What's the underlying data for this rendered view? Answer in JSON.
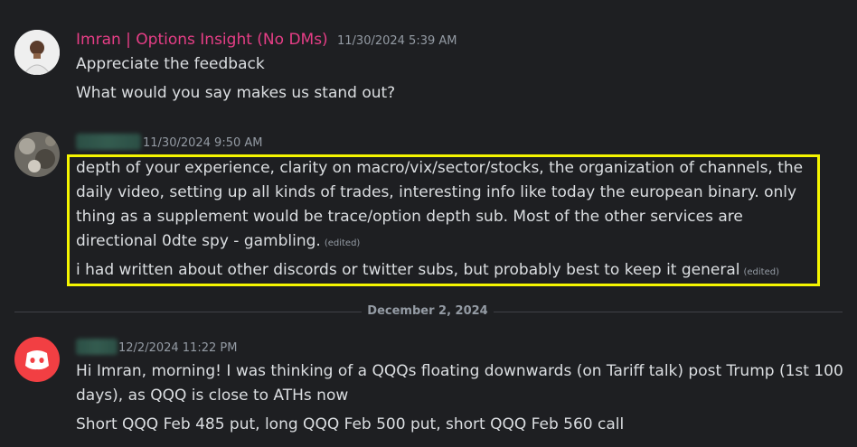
{
  "messages": [
    {
      "author": "Imran | Options Insight (No DMs)",
      "author_color": "#e63e86",
      "timestamp": "11/30/2024 5:39 AM",
      "avatar": "user-photo-icon",
      "lines": [
        "Appreciate the feedback",
        "What would you say makes us stand out?"
      ]
    },
    {
      "author_redacted": true,
      "timestamp": "11/30/2024 9:50 AM",
      "avatar": "user-photo-icon",
      "lines": [
        "depth of your experience,  clarity on macro/vix/sector/stocks, the organization of channels, the",
        "daily video, setting up all kinds of trades, interesting info like today the european binary.  only",
        "thing as a supplement would be trace/option depth sub.  Most of the other services are",
        "directional 0dte spy -  gambling.",
        "i had written about other discords or twitter subs, but probably best to  keep it general"
      ],
      "edited_label": "(edited)",
      "highlight_color": "#f5f500"
    },
    {
      "author_redacted": true,
      "timestamp": "12/2/2024 11:22 PM",
      "avatar": "discord-logo-icon",
      "avatar_color": "#f23f43",
      "lines": [
        "Hi Imran, morning! I was thinking of a QQQs floating downwards (on Tariff talk) post Trump (1st 100",
        "days), as QQQ is close to ATHs now",
        "Short QQQ Feb 485 put, long QQQ Feb 500 put, short QQQ Feb 560 call"
      ]
    }
  ],
  "date_divider": "December 2, 2024",
  "colors": {
    "background": "#1e1f22",
    "text": "#dbdee1",
    "muted": "#949ba4"
  }
}
